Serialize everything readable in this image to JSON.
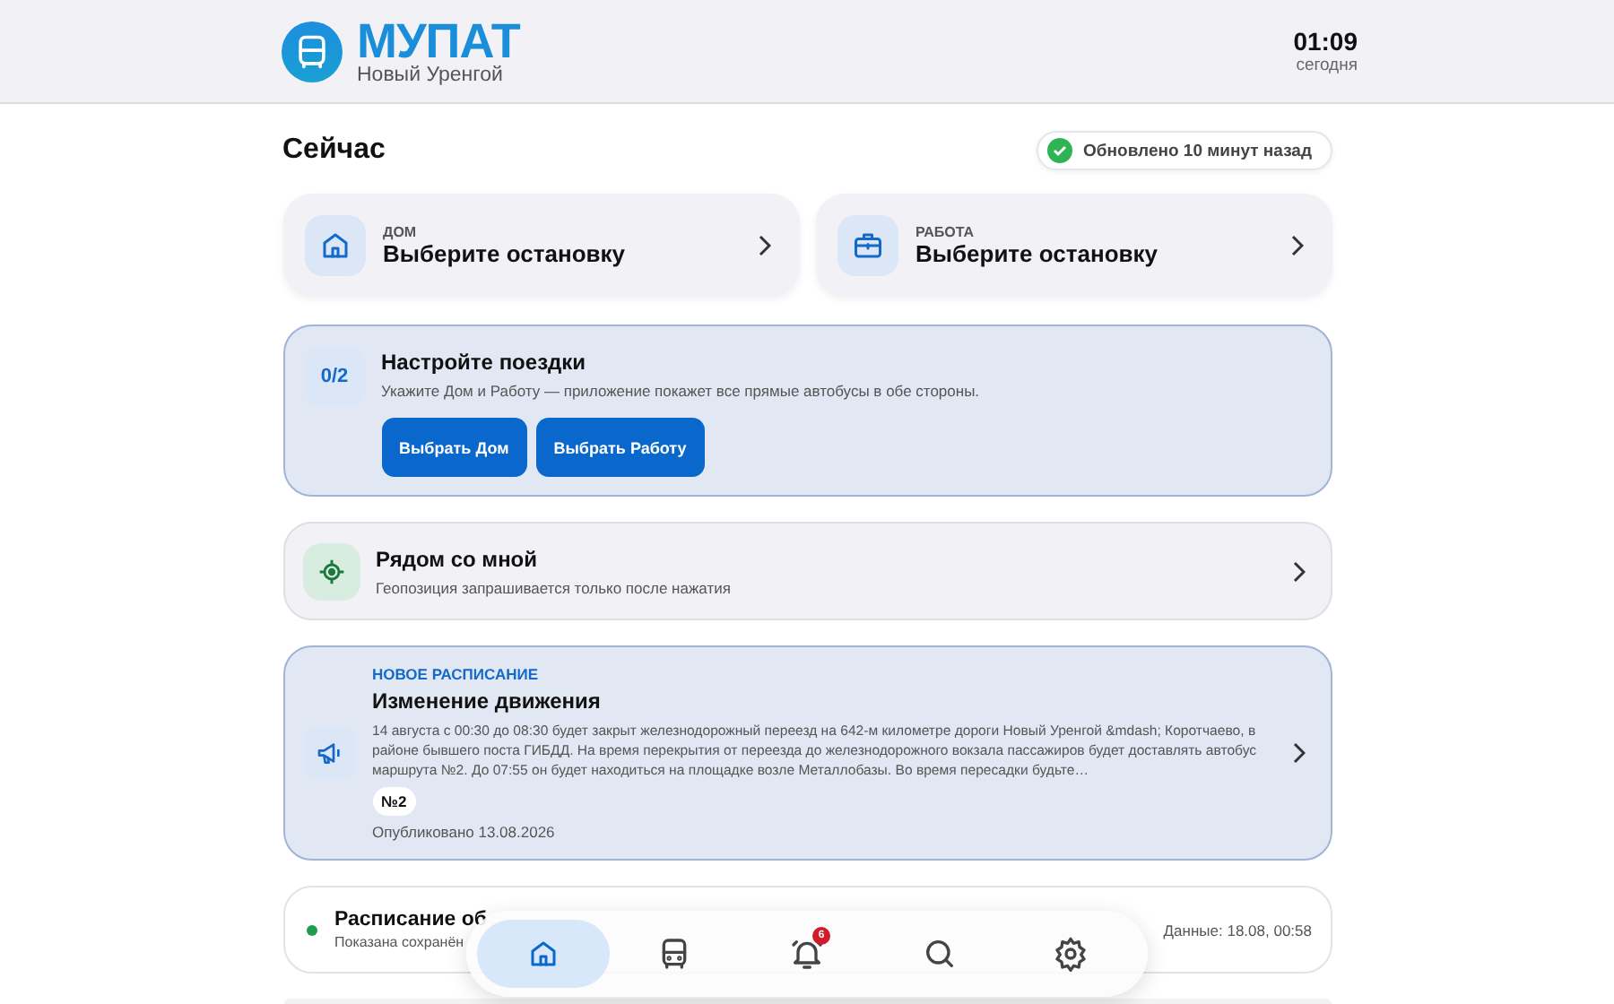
{
  "header": {
    "title": "МУПАТ",
    "city": "Новый Уренгой",
    "time": "01:09",
    "day": "сегодня"
  },
  "now": {
    "heading": "Сейчас",
    "updated": "Обновлено 10 минут назад"
  },
  "stops": [
    {
      "kind": "home",
      "label": "ДОМ",
      "value": "Выберите остановку"
    },
    {
      "kind": "work",
      "label": "РАБОТА",
      "value": "Выберите остановку"
    }
  ],
  "setup": {
    "progress": "0/2",
    "title": "Настройте поездки",
    "text": "Укажите Дом и Работу — приложение покажет все прямые автобусы в обе стороны.",
    "buttons": [
      "Выбрать Дом",
      "Выбрать Работу"
    ]
  },
  "nearby": {
    "title": "Рядом со мной",
    "text": "Геопозиция запрашивается только после нажатия"
  },
  "news": {
    "tag": "НОВОЕ РАСПИСАНИЕ",
    "title": "Изменение движения",
    "text": "14 августа с 00:30 до 08:30 будет закрыт железнодорожный переезд на 642-м километре дороги Новый Уренгой &mdash; Коротчаево, в районе бывшего поста ГИБДД. На время перекрытия от переезда до железнодорожного вокзала пассажиров будет доставлять автобус маршрута №2. До 07:55 он будет находиться на площадке возле Металлобазы. Во время пересадки будьте…",
    "route": "№2",
    "published": "Опубликовано 13.08.2026"
  },
  "status": {
    "title": "Расписание об",
    "text": "Показана сохранён",
    "data": "Данные: 18.08, 00:58"
  },
  "nav": [
    {
      "kind": "home",
      "selected": true
    },
    {
      "kind": "bus",
      "selected": false
    },
    {
      "kind": "bell",
      "selected": false,
      "badge": "6"
    },
    {
      "kind": "search",
      "selected": false
    },
    {
      "kind": "settings",
      "selected": false
    }
  ]
}
